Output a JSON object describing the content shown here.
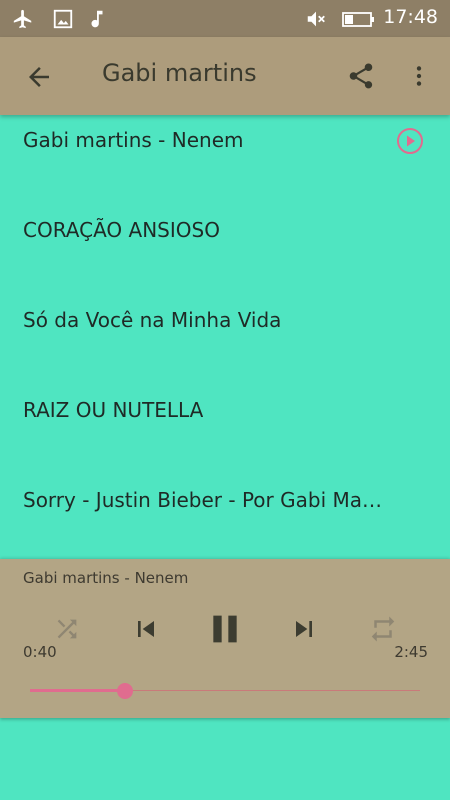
{
  "status_bar": {
    "time": "17:48",
    "icons": [
      "airplane-icon",
      "image-icon",
      "music-note-icon",
      "mute-icon",
      "battery-icon"
    ]
  },
  "app_bar": {
    "title": "Gabi martins",
    "back_icon": "arrow-back-icon",
    "share_icon": "share-icon",
    "more_icon": "more-vert-icon"
  },
  "songs": [
    {
      "title": "Gabi martins - Nenem",
      "playing": true
    },
    {
      "title": "CORAÇÃO ANSIOSO",
      "playing": false
    },
    {
      "title": "Só da Você na Minha Vida",
      "playing": false
    },
    {
      "title": "RAIZ OU NUTELLA",
      "playing": false
    },
    {
      "title": "Sorry - Justin Bieber - Por Gabi Martins",
      "playing": false
    }
  ],
  "player": {
    "now_playing": "Gabi martins - Nenem",
    "elapsed": "0:40",
    "duration": "2:45",
    "progress": 0.243,
    "controls": [
      "shuffle-icon",
      "skip-previous-icon",
      "pause-icon",
      "skip-next-icon",
      "repeat-icon"
    ]
  },
  "colors": {
    "background": "#4FE5C1",
    "status_bar": "#8E7F66",
    "app_bar": "#AD9C7C",
    "player": "#B3A585",
    "accent": "#E06C8F"
  }
}
